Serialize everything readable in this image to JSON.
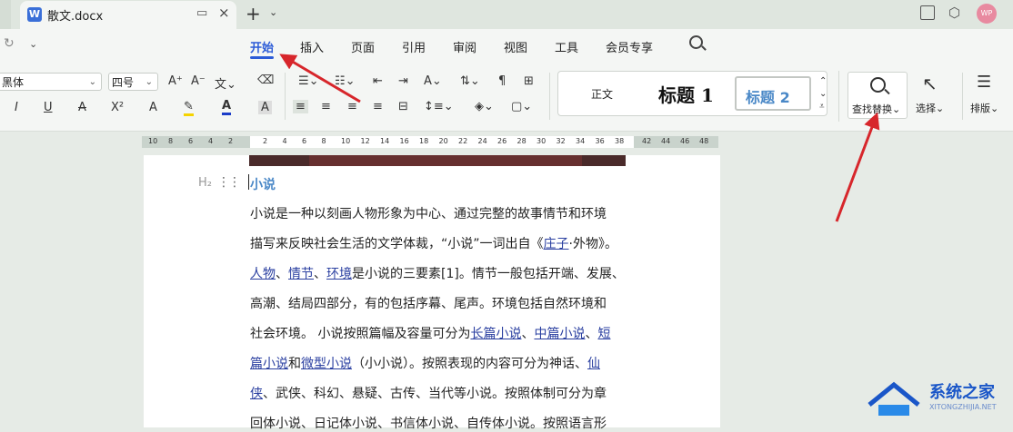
{
  "titlebar": {
    "filename": "散文.docx",
    "app_icon_letter": "W",
    "new_tab": "+",
    "close": "×",
    "avatar": "WP"
  },
  "menu": {
    "items": [
      "开始",
      "插入",
      "页面",
      "引用",
      "审阅",
      "视图",
      "工具",
      "会员专享"
    ]
  },
  "ribbon": {
    "font_name": "黑体",
    "font_size": "四号",
    "styles": {
      "normal": "正文",
      "h1": "标题 1",
      "h2": "标题 2"
    },
    "find_replace": "查找替换",
    "select": "选择",
    "layout": "排版"
  },
  "ruler": {
    "left_ticks": [
      "10",
      "8",
      "6",
      "4",
      "2"
    ],
    "right_ticks": [
      "2",
      "4",
      "6",
      "8",
      "10",
      "12",
      "14",
      "16",
      "18",
      "20",
      "22",
      "24",
      "26",
      "28",
      "30",
      "32",
      "34",
      "36",
      "38"
    ],
    "outer_ticks": [
      "42",
      "44",
      "46",
      "48"
    ]
  },
  "document": {
    "heading_marker": "H₂",
    "heading": "小说",
    "lines": [
      [
        {
          "t": "小说是一种以刻画人物形象为中心、通过完整的故事情节和环境"
        }
      ],
      [
        {
          "t": "描写来反映社会生活的文学体裁，“小说”一词出自《"
        },
        {
          "t": "庄子",
          "l": true
        },
        {
          "t": "·外物》。"
        }
      ],
      [
        {
          "t": "人物",
          "l": true
        },
        {
          "t": "、"
        },
        {
          "t": "情节",
          "l": true
        },
        {
          "t": "、"
        },
        {
          "t": "环境",
          "l": true
        },
        {
          "t": "是小说的三要素[1]。情节一般包括开端、发展、"
        }
      ],
      [
        {
          "t": "高潮、结局四部分，有的包括序幕、尾声。环境包括自然环境和"
        }
      ],
      [
        {
          "t": "社会环境。 小说按照篇幅及容量可分为"
        },
        {
          "t": "长篇小说",
          "l": true
        },
        {
          "t": "、"
        },
        {
          "t": "中篇小说",
          "l": true
        },
        {
          "t": "、"
        },
        {
          "t": "短",
          "l": true
        }
      ],
      [
        {
          "t": "篇小说",
          "l": true
        },
        {
          "t": "和"
        },
        {
          "t": "微型小说",
          "l": true
        },
        {
          "t": "（小小说）。按照表现的内容可分为神话、"
        },
        {
          "t": "仙",
          "l": true
        }
      ],
      [
        {
          "t": "侠",
          "l": true
        },
        {
          "t": "、武侠、科幻、悬疑、古传、当代等小说。按照体制可分为章"
        }
      ],
      [
        {
          "t": "回体小说、日记体小说、书信体小说、自传体小说。按照语言形"
        }
      ]
    ]
  },
  "watermark": {
    "name": "系统之家",
    "url": "XITONGZHIJIA.NET"
  },
  "colors": {
    "accent": "#2b5bd7",
    "annotation_arrow": "#d7262b",
    "heading": "#4a88c7"
  }
}
